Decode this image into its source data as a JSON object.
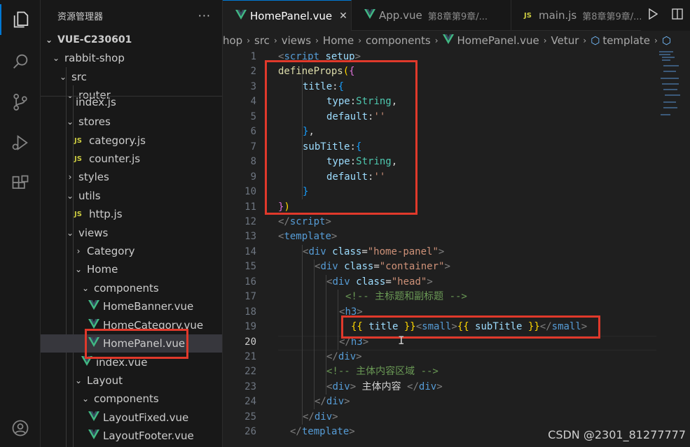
{
  "activity_bar": {
    "icons": [
      "explorer-icon",
      "search-icon",
      "source-control-icon",
      "run-debug-icon",
      "extensions-icon",
      "account-icon"
    ]
  },
  "sidebar": {
    "title": "资源管理器",
    "more": "···",
    "items": [
      {
        "label": "VUE-C230601",
        "kind": "root",
        "expanded": true
      },
      {
        "label": "rabbit-shop",
        "kind": "folder",
        "expanded": true
      },
      {
        "label": "src",
        "kind": "folder",
        "expanded": true
      },
      {
        "label": "router",
        "kind": "folder",
        "expanded": true
      },
      {
        "label": "index.js",
        "kind": "js"
      },
      {
        "label": "stores",
        "kind": "folder",
        "expanded": true
      },
      {
        "label": "category.js",
        "kind": "js"
      },
      {
        "label": "counter.js",
        "kind": "js"
      },
      {
        "label": "styles",
        "kind": "folder",
        "expanded": false
      },
      {
        "label": "utils",
        "kind": "folder",
        "expanded": true
      },
      {
        "label": "http.js",
        "kind": "js"
      },
      {
        "label": "views",
        "kind": "folder",
        "expanded": true
      },
      {
        "label": "Category",
        "kind": "folder",
        "expanded": false
      },
      {
        "label": "Home",
        "kind": "folder",
        "expanded": true
      },
      {
        "label": "components",
        "kind": "folder",
        "expanded": true
      },
      {
        "label": "HomeBanner.vue",
        "kind": "vue"
      },
      {
        "label": "HomeCategory.vue",
        "kind": "vue"
      },
      {
        "label": "HomePanel.vue",
        "kind": "vue",
        "selected": true
      },
      {
        "label": "index.vue",
        "kind": "vue"
      },
      {
        "label": "Layout",
        "kind": "folder",
        "expanded": true
      },
      {
        "label": "components",
        "kind": "folder",
        "expanded": true
      },
      {
        "label": "LayoutFixed.vue",
        "kind": "vue"
      },
      {
        "label": "LayoutFooter.vue",
        "kind": "vue"
      }
    ]
  },
  "tabs": [
    {
      "label": "HomePanel.vue",
      "sub": "",
      "active": true,
      "close": "✕"
    },
    {
      "label": "App.vue",
      "sub": "第8章第9章/...",
      "active": false
    },
    {
      "label": "main.js",
      "sub": "第8章第9章/...",
      "active": false
    }
  ],
  "breadcrumb": [
    "hop",
    "src",
    "views",
    "Home",
    "components",
    "HomePanel.vue",
    "Vetur",
    "template",
    ""
  ],
  "editor": {
    "current_line": 20,
    "line_numbers": [
      "1",
      "2",
      "3",
      "4",
      "5",
      "6",
      "7",
      "8",
      "9",
      "10",
      "11",
      "12",
      "13",
      "14",
      "15",
      "16",
      "17",
      "18",
      "19",
      "20",
      "21",
      "22",
      "23",
      "24",
      "25",
      "26"
    ]
  },
  "code": {
    "l1": {
      "a": "<",
      "b": "script",
      "c": " setup",
      "d": ">"
    },
    "l2": {
      "a": "defineProps",
      "b": "(",
      "c": "{"
    },
    "l3": {
      "a": "title",
      "b": ":",
      "c": "{"
    },
    "l4": {
      "a": "type",
      "b": ":",
      "c": "String",
      "d": ","
    },
    "l5": {
      "a": "default",
      "b": ":",
      "c": "''"
    },
    "l6": {
      "a": "}",
      "b": ","
    },
    "l7": {
      "a": "subTitle",
      "b": ":",
      "c": "{"
    },
    "l8": {
      "a": "type",
      "b": ":",
      "c": "String",
      "d": ","
    },
    "l9": {
      "a": "default",
      "b": ":",
      "c": "''"
    },
    "l10": {
      "a": "}"
    },
    "l11": {
      "a": "}",
      "b": ")"
    },
    "l12": {
      "a": "</",
      "b": "script",
      "c": ">"
    },
    "l13": {
      "a": "<",
      "b": "template",
      "c": ">"
    },
    "l14": {
      "a": "<",
      "b": "div",
      "c": " class",
      "d": "=",
      "e": "\"home-panel\"",
      "f": ">"
    },
    "l15": {
      "a": "<",
      "b": "div",
      "c": " class",
      "d": "=",
      "e": "\"container\"",
      "f": ">"
    },
    "l16": {
      "a": "<",
      "b": "div",
      "c": " class",
      "d": "=",
      "e": "\"head\"",
      "f": ">"
    },
    "l17": {
      "a": "<!-- 主标题和副标题 -->"
    },
    "l18": {
      "a": "<",
      "b": "h3",
      "c": ">"
    },
    "l19": {
      "a": "{{",
      "b": " title ",
      "c": "}}",
      "d": "<",
      "e": "small",
      "f": ">",
      "g": "{{",
      "h": " subTitle ",
      "i": "}}",
      "j": "</",
      "k": "small",
      "l": ">"
    },
    "l20": {
      "a": "</",
      "b": "h3",
      "c": ">"
    },
    "l21": {
      "a": "</",
      "b": "div",
      "c": ">"
    },
    "l22": {
      "a": "<!-- 主体内容区域 -->"
    },
    "l23": {
      "a": "<",
      "b": "div",
      "c": ">",
      "d": " 主体内容 ",
      "e": "</",
      "f": "div",
      "g": ">"
    },
    "l24": {
      "a": "</",
      "b": "div",
      "c": ">"
    },
    "l25": {
      "a": "</",
      "b": "div",
      "c": ">"
    },
    "l26": {
      "a": "</",
      "b": "template",
      "c": ">"
    }
  },
  "mouse_cursor": "I",
  "watermark": "CSDN @2301_81277777",
  "colors": {
    "highlight_box": "#e0392b",
    "accent": "#0078d4"
  }
}
